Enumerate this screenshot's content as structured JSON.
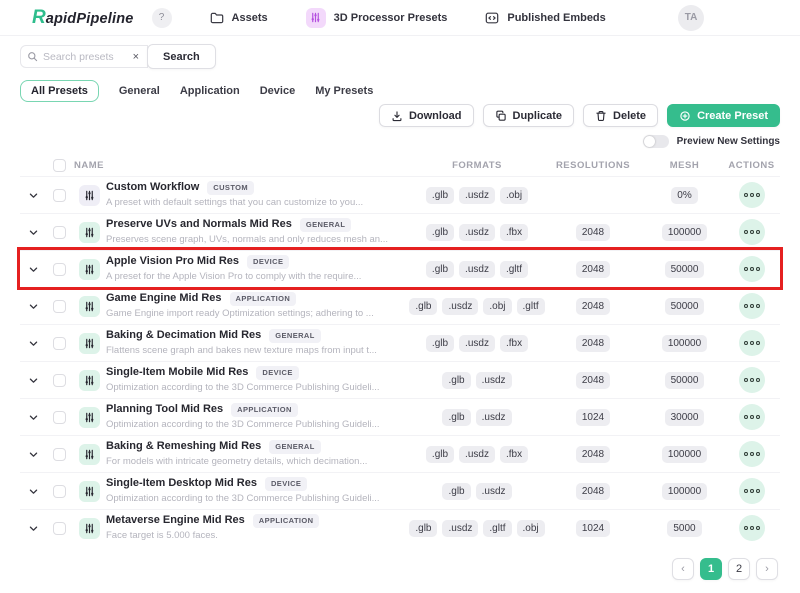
{
  "navbar": {
    "logo": {
      "prefix": "R",
      "rest": "apidPipeline"
    },
    "help": "?",
    "items": [
      {
        "label": "Assets",
        "icon": "folder-icon"
      },
      {
        "label": "3D Processor Presets",
        "icon": "sliders-icon",
        "active": true
      },
      {
        "label": "Published Embeds",
        "icon": "embed-icon"
      }
    ],
    "avatar": "TA"
  },
  "search": {
    "placeholder": "Search presets",
    "clear": "×",
    "button": "Search"
  },
  "tabs": [
    {
      "label": "All Presets",
      "active": true
    },
    {
      "label": "General"
    },
    {
      "label": "Application"
    },
    {
      "label": "Device"
    },
    {
      "label": "My Presets"
    }
  ],
  "toolbar": {
    "download": "Download",
    "duplicate": "Duplicate",
    "delete": "Delete",
    "create": "Create Preset"
  },
  "preview_toggle": {
    "label": "Preview New Settings",
    "on": false
  },
  "table": {
    "headers": {
      "name": "NAME",
      "formats": "FORMATS",
      "resolutions": "RESOLUTIONS",
      "mesh": "MESH",
      "actions": "ACTIONS"
    },
    "rows": [
      {
        "name": "Custom Workflow",
        "tag": "CUSTOM",
        "description": "A preset with default settings that you can customize to you...",
        "formats": [
          ".glb",
          ".usdz",
          ".obj"
        ],
        "resolution": "",
        "mesh": "0%",
        "highlighted": false,
        "icon_variant": "custom"
      },
      {
        "name": "Preserve UVs and Normals Mid Res",
        "tag": "GENERAL",
        "description": "Preserves scene graph, UVs, normals and only reduces mesh an...",
        "formats": [
          ".glb",
          ".usdz",
          ".fbx"
        ],
        "resolution": "2048",
        "mesh": "100000",
        "highlighted": false
      },
      {
        "name": "Apple Vision Pro Mid Res",
        "tag": "DEVICE",
        "description": "A preset for the Apple Vision Pro to comply with the require...",
        "formats": [
          ".glb",
          ".usdz",
          ".gltf"
        ],
        "resolution": "2048",
        "mesh": "50000",
        "highlighted": true
      },
      {
        "name": "Game Engine Mid Res",
        "tag": "APPLICATION",
        "description": "Game Engine import ready Optimization settings; adhering to ...",
        "formats": [
          ".glb",
          ".usdz",
          ".obj",
          ".gltf"
        ],
        "resolution": "2048",
        "mesh": "50000",
        "highlighted": false
      },
      {
        "name": "Baking & Decimation Mid Res",
        "tag": "GENERAL",
        "description": "Flattens scene graph and bakes new texture maps from input t...",
        "formats": [
          ".glb",
          ".usdz",
          ".fbx"
        ],
        "resolution": "2048",
        "mesh": "100000",
        "highlighted": false
      },
      {
        "name": "Single-Item Mobile Mid Res",
        "tag": "DEVICE",
        "description": "Optimization according to the 3D Commerce Publishing Guideli...",
        "formats": [
          ".glb",
          ".usdz"
        ],
        "resolution": "2048",
        "mesh": "50000",
        "highlighted": false
      },
      {
        "name": "Planning Tool Mid Res",
        "tag": "APPLICATION",
        "description": "Optimization according to the 3D Commerce Publishing Guideli...",
        "formats": [
          ".glb",
          ".usdz"
        ],
        "resolution": "1024",
        "mesh": "30000",
        "highlighted": false
      },
      {
        "name": "Baking & Remeshing Mid Res",
        "tag": "GENERAL",
        "description": "For models with intricate geometry details, which decimation...",
        "formats": [
          ".glb",
          ".usdz",
          ".fbx"
        ],
        "resolution": "2048",
        "mesh": "100000",
        "highlighted": false
      },
      {
        "name": "Single-Item Desktop Mid Res",
        "tag": "DEVICE",
        "description": "Optimization according to the 3D Commerce Publishing Guideli...",
        "formats": [
          ".glb",
          ".usdz"
        ],
        "resolution": "2048",
        "mesh": "100000",
        "highlighted": false
      },
      {
        "name": "Metaverse Engine Mid Res",
        "tag": "APPLICATION",
        "description": "Face target is 5.000 faces.",
        "formats": [
          ".glb",
          ".usdz",
          ".gltf",
          ".obj"
        ],
        "resolution": "1024",
        "mesh": "5000",
        "highlighted": false
      }
    ]
  },
  "pagination": {
    "prev": "‹",
    "pages": [
      {
        "label": "1",
        "active": true
      },
      {
        "label": "2",
        "active": false
      }
    ],
    "next": "›"
  },
  "colors": {
    "brand_green": "#35bd8d",
    "mint": "#ddf3e9",
    "nav_purple": "#b44fe0",
    "nav_purple_bg": "#f3d9fb",
    "highlight_red": "#e52020",
    "chip_bg": "#ededf1",
    "tag_bg": "#f1f1f6"
  },
  "icons": {
    "nav": [
      "folder-icon",
      "sliders-icon",
      "embed-icon"
    ],
    "toolbar": [
      "download-icon",
      "duplicate-icon",
      "trash-icon",
      "plus-circle-icon"
    ],
    "row": [
      "chevron-down-icon",
      "sliders-icon",
      "ellipsis-icon"
    ],
    "search": [
      "search-icon",
      "clear-icon"
    ]
  }
}
